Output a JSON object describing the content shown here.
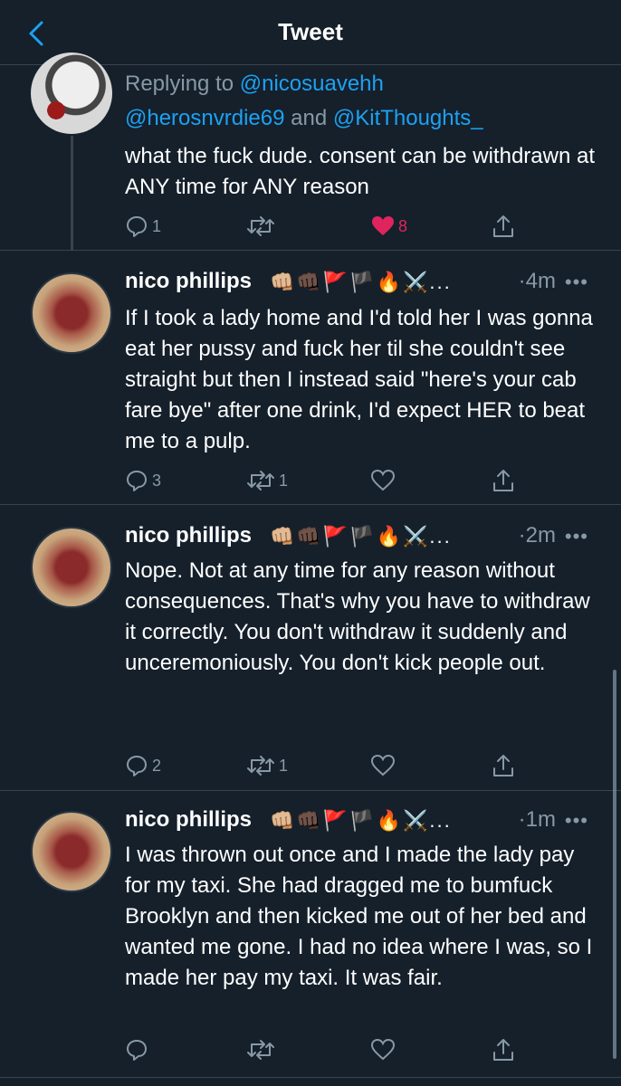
{
  "header": {
    "title": "Tweet"
  },
  "tweets": [
    {
      "reply_prefix": "Replying to ",
      "mentions": [
        "@nicosuavehh",
        "@herosnvrdie69",
        "@KitThoughts_"
      ],
      "and_word": " and ",
      "text": "what the fuck dude. consent can be withdrawn at ANY time for ANY reason",
      "replies": "1",
      "retweets": "",
      "likes": "8",
      "liked": true
    },
    {
      "name": "nico phillips",
      "emojis": "👊🏼👊🏿🚩🏴🔥⚔️...",
      "time": "·4m",
      "text": "If I took a lady home and I'd told her I was gonna eat her pussy and fuck her til she couldn't see straight but then I instead said \"here's your cab fare bye\" after one drink, I'd expect HER to beat me to a pulp.",
      "replies": "3",
      "retweets": "1",
      "likes": ""
    },
    {
      "name": "nico phillips",
      "emojis": "👊🏼👊🏿🚩🏴🔥⚔️...",
      "time": "·2m",
      "text": "Nope. Not at any time for any reason without consequences. That's why you have to withdraw it correctly. You don't withdraw it suddenly and unceremoniously. You don't kick people out.",
      "replies": "2",
      "retweets": "1",
      "likes": ""
    },
    {
      "name": "nico phillips",
      "emojis": "👊🏼👊🏿🚩🏴🔥⚔️...",
      "time": "·1m",
      "text": "I was thrown out once and I made the lady pay for my taxi. She had dragged me to bumfuck Brooklyn and then kicked me out of her bed and wanted me gone. I had no idea where I was, so I made her pay my taxi. It was fair.",
      "replies": "",
      "retweets": "",
      "likes": ""
    }
  ],
  "icons": {
    "back": "chevron-left-icon",
    "reply": "reply-icon",
    "retweet": "retweet-icon",
    "like": "heart-icon",
    "share": "share-icon",
    "more": "more-icon"
  },
  "colors": {
    "background": "#15202b",
    "border": "#38444d",
    "secondary_text": "#8899a6",
    "accent": "#1da1f2",
    "like": "#e0245e"
  }
}
